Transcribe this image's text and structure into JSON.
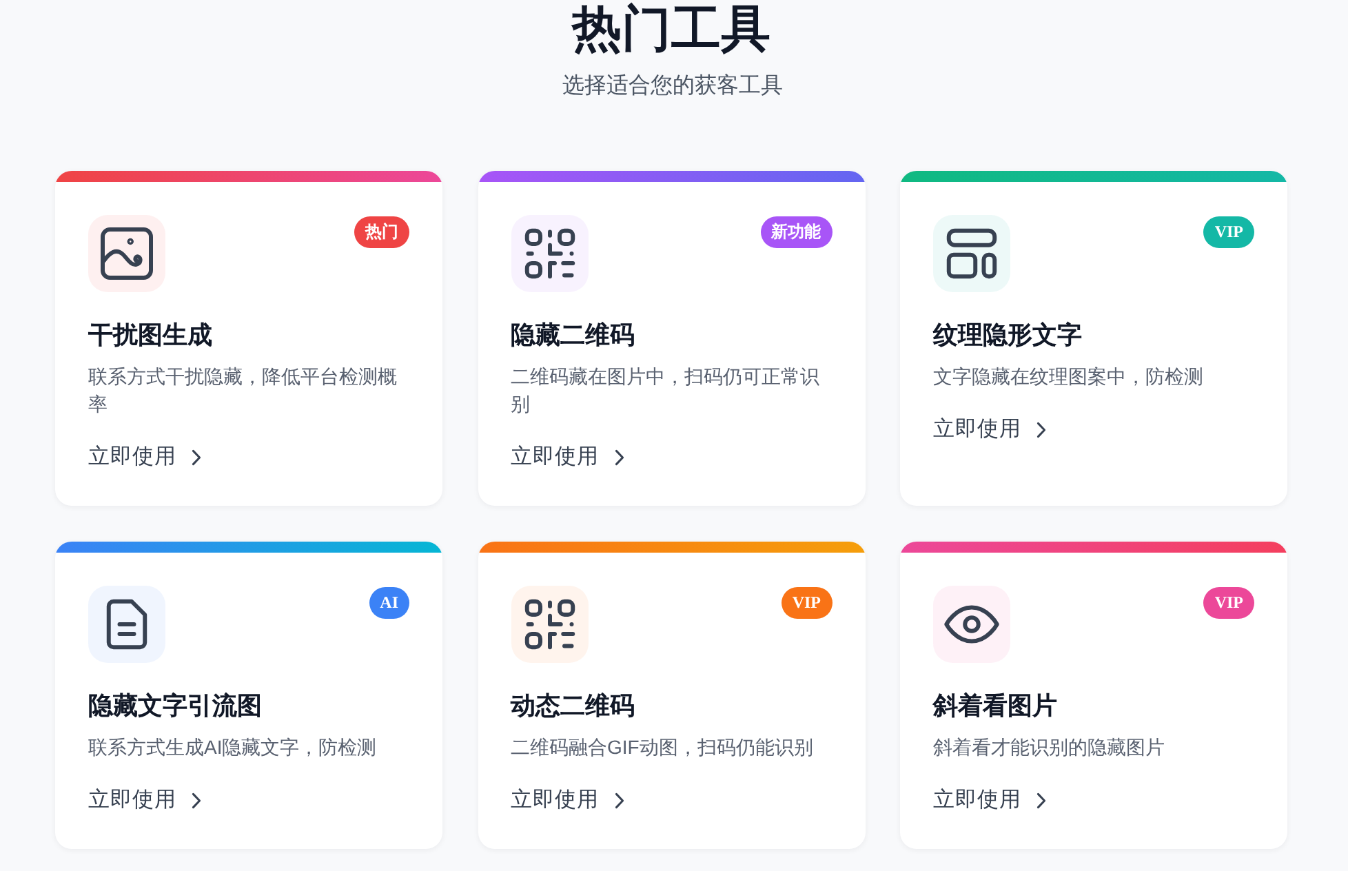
{
  "header": {
    "title": "热门工具",
    "subtitle": "选择适合您的获客工具"
  },
  "cards": [
    {
      "kind": "image",
      "badge": "热门",
      "color": "#ef4444",
      "gradient": [
        {
          "color": "#ef4444"
        },
        {
          "color": "#ec4899"
        }
      ],
      "title": "干扰图生成",
      "description": "联系方式干扰隐藏，降低平台检测概率",
      "action": "立即使用"
    },
    {
      "kind": "qr",
      "badge": "新功能",
      "color": "#a855f7",
      "gradient": [
        {
          "color": "#a855f7"
        },
        {
          "color": "#6366f1"
        }
      ],
      "title": "隐藏二维码",
      "description": "二维码藏在图片中，扫码仍可正常识别",
      "action": "立即使用"
    },
    {
      "kind": "layout",
      "badge": "VIP",
      "color": "#14b8a6",
      "gradient": [
        {
          "color": "#10b981"
        },
        {
          "color": "#14b8a6"
        }
      ],
      "title": "纹理隐形文字",
      "description": "文字隐藏在纹理图案中，防检测",
      "action": "立即使用"
    },
    {
      "kind": "document",
      "badge": "AI",
      "color": "#3b82f6",
      "gradient": [
        {
          "color": "#3b82f6"
        },
        {
          "color": "#06b6d4"
        }
      ],
      "title": "隐藏文字引流图",
      "description": "联系方式生成AI隐藏文字，防检测",
      "action": "立即使用"
    },
    {
      "kind": "qr",
      "badge": "VIP",
      "color": "#f97316",
      "gradient": [
        {
          "color": "#f97316"
        },
        {
          "color": "#f59e0b"
        }
      ],
      "title": "动态二维码",
      "description": "二维码融合GIF动图，扫码仍能识别",
      "action": "立即使用"
    },
    {
      "kind": "eye",
      "badge": "VIP",
      "color": "#ec4899",
      "gradient": [
        {
          "color": "#ec4899"
        },
        {
          "color": "#f43f5e"
        }
      ],
      "title": "斜着看图片",
      "description": "斜着看才能识别的隐藏图片",
      "action": "立即使用"
    }
  ]
}
